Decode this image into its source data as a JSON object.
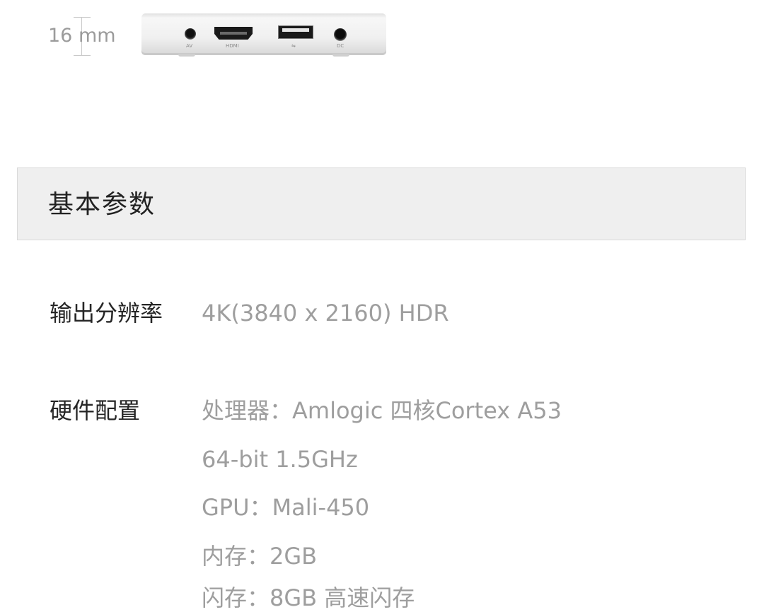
{
  "dimension": {
    "label": "16 mm"
  },
  "device": {
    "ports": [
      {
        "name": "av",
        "label": "AV"
      },
      {
        "name": "hdmi",
        "label": "HDMI"
      },
      {
        "name": "usb",
        "label": "⇋"
      },
      {
        "name": "dc",
        "label": "DC"
      }
    ]
  },
  "section": {
    "title": "基本参数"
  },
  "specs": [
    {
      "label": "输出分辨率",
      "values": [
        "4K(3840 x 2160) HDR"
      ]
    },
    {
      "label": "硬件配置",
      "values": [
        "处理器：Amlogic  四核Cortex A53",
        "64-bit 1.5GHz",
        "GPU：Mali-450",
        "内存：2GB",
        "闪存：8GB 高速闪存"
      ]
    }
  ]
}
